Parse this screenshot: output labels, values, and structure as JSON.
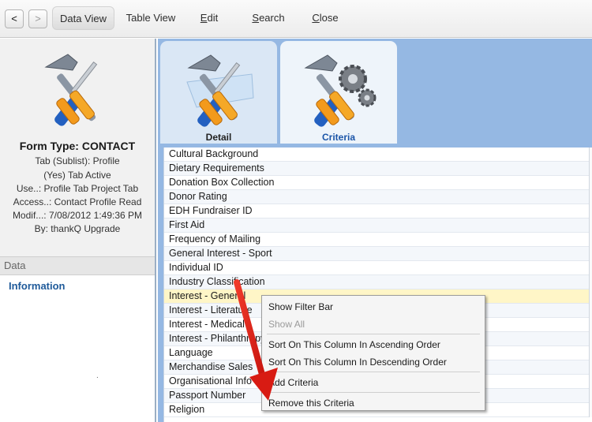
{
  "toolbar": {
    "back_label": "<",
    "forward_label": ">",
    "items": [
      {
        "label": "Data View",
        "underline": "",
        "rest": ""
      },
      {
        "label": "Table View",
        "underline": "",
        "rest": ""
      },
      {
        "label": "",
        "underline": "E",
        "rest": "dit"
      },
      {
        "label": "",
        "underline": "S",
        "rest": "earch"
      },
      {
        "label": "",
        "underline": "C",
        "rest": "lose"
      }
    ]
  },
  "form": {
    "type_title": "Form Type: CONTACT",
    "info_lines": [
      "Tab (Sublist): Profile",
      "(Yes) Tab Active",
      "Use..: Profile Tab  Project Tab",
      "Access..: Contact Profile Read",
      "Modif...: 7/08/2012 1:49:36 PM",
      "By: thankQ Upgrade"
    ]
  },
  "data_panel": {
    "header": "Data",
    "items": [
      "Information"
    ],
    "stray_text": "."
  },
  "tabs": [
    {
      "label": "Detail",
      "icon": "tools-icon"
    },
    {
      "label": "Criteria",
      "icon": "tools-gears-icon"
    }
  ],
  "criteria_list": [
    "Cultural Background",
    "Dietary Requirements",
    "Donation Box Collection",
    "Donor Rating",
    "EDH Fundraiser ID",
    "First Aid",
    "Frequency of Mailing",
    "General Interest - Sport",
    "Individual ID",
    "Industry Classification",
    "Interest - General",
    "Interest - Literature",
    "Interest - Medical",
    "Interest - Philanthropy",
    "Language",
    "Merchandise Sales",
    "Organisational Info",
    "Passport Number",
    "Religion"
  ],
  "context_menu": {
    "items": [
      {
        "label": "Show Filter Bar",
        "disabled": false
      },
      {
        "label": "Show All",
        "disabled": true
      },
      {
        "label": "Sort On This Column In Ascending Order",
        "disabled": false
      },
      {
        "label": "Sort On This Column In Descending Order",
        "disabled": false
      },
      {
        "label": "Add Criteria",
        "disabled": false
      },
      {
        "label": "Remove this Criteria",
        "disabled": false
      }
    ]
  },
  "colors": {
    "accent_blue": "#1f5a9a",
    "right_panel_bg": "#95b8e3",
    "selected_row": "#fff6c7",
    "annotation_arrow": "#e8201a"
  }
}
